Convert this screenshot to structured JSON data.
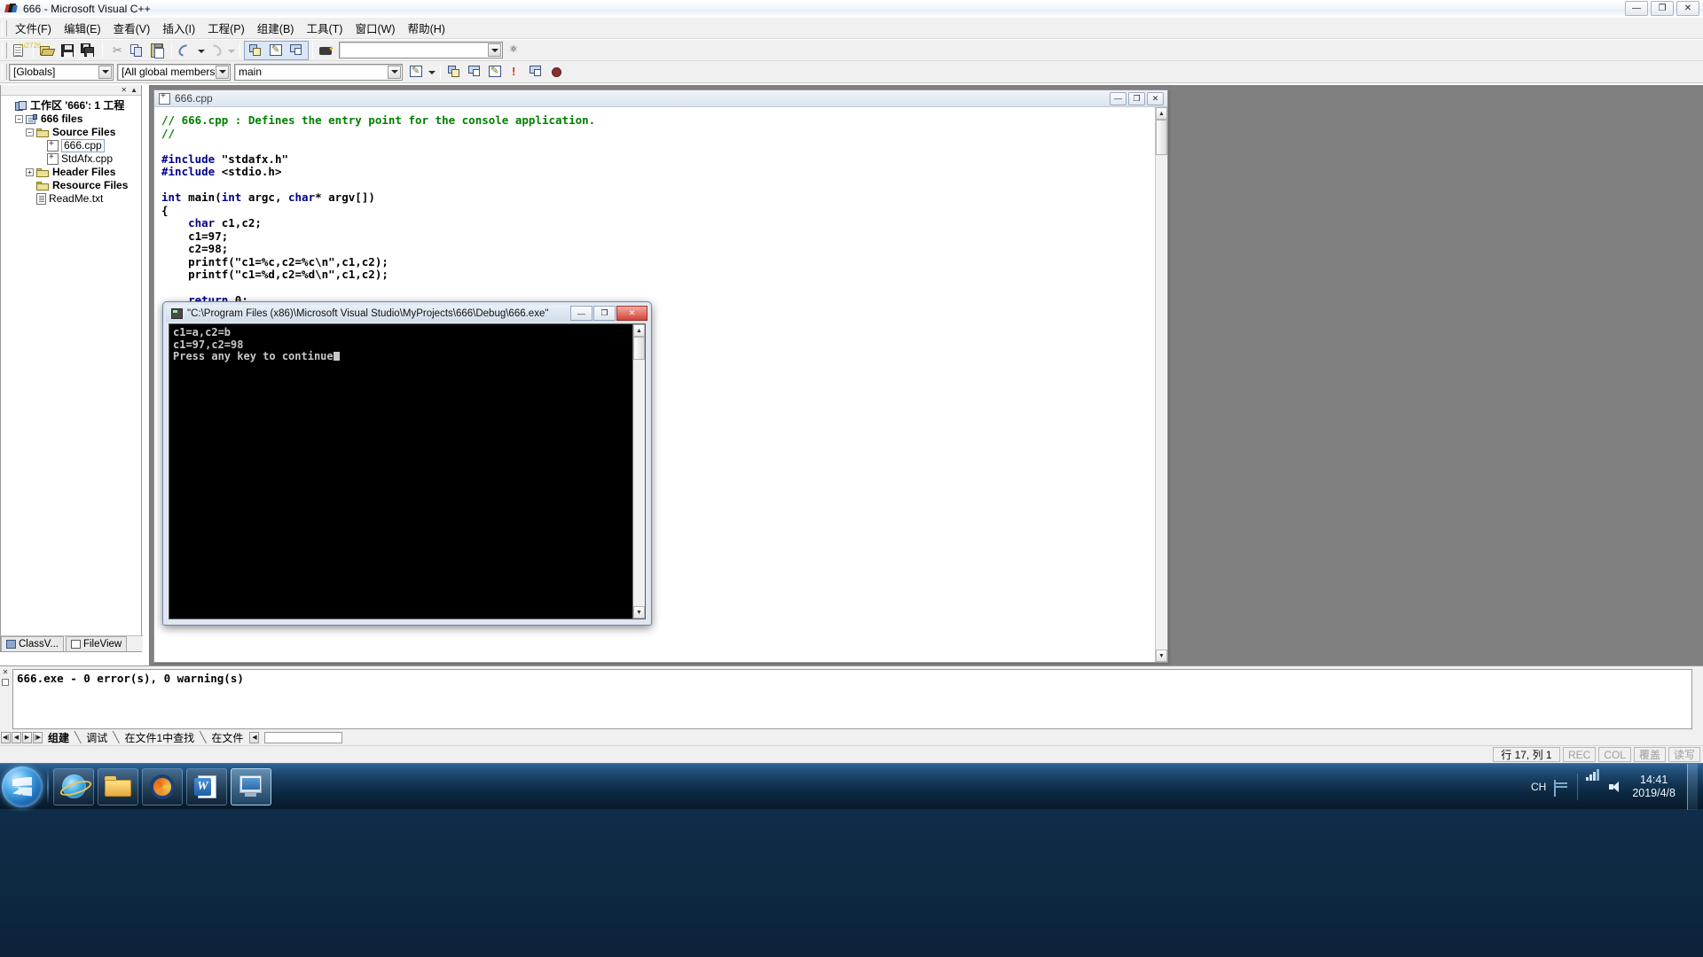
{
  "window": {
    "title": "666 - Microsoft Visual C++",
    "buttons": {
      "minimize": "—",
      "maximize": "❐",
      "close": "✕"
    }
  },
  "menu": {
    "items": [
      {
        "label": "文件(F)"
      },
      {
        "label": "编辑(E)"
      },
      {
        "label": "查看(V)"
      },
      {
        "label": "插入(I)"
      },
      {
        "label": "工程(P)"
      },
      {
        "label": "组建(B)"
      },
      {
        "label": "工具(T)"
      },
      {
        "label": "窗口(W)"
      },
      {
        "label": "帮助(H)"
      }
    ]
  },
  "toolbar": {
    "buttons": [
      {
        "name": "new-document",
        "icon": "new-document-icon"
      },
      {
        "name": "open-file",
        "icon": "open-folder-icon"
      },
      {
        "name": "save",
        "icon": "save-icon"
      },
      {
        "name": "save-all",
        "icon": "save-all-icon"
      },
      {
        "name": "cut",
        "icon": "scissors-icon"
      },
      {
        "name": "copy",
        "icon": "copy-icon"
      },
      {
        "name": "paste",
        "icon": "clipboard-icon"
      },
      {
        "name": "undo",
        "icon": "undo-arrow-icon"
      },
      {
        "name": "redo",
        "icon": "redo-arrow-icon"
      },
      {
        "name": "workspace",
        "icon": "workspace-window-icon"
      },
      {
        "name": "output-window",
        "icon": "output-window-icon"
      },
      {
        "name": "window-list",
        "icon": "window-list-icon"
      },
      {
        "name": "find-in-files",
        "icon": "binoculars-icon"
      }
    ],
    "find_box": {
      "value": "",
      "placeholder": ""
    },
    "find_button": {
      "name": "find-button",
      "icon": "binoculars-icon"
    }
  },
  "combobar": {
    "globals": {
      "value": "[Globals]"
    },
    "members": {
      "value": "[All global members"
    },
    "symbol": {
      "value": "main"
    },
    "extra_buttons": [
      {
        "name": "go-to-definition",
        "icon": "definition-icon"
      },
      {
        "name": "dropdown",
        "icon": "chevron-down-icon"
      }
    ]
  },
  "workspace": {
    "tree": [
      {
        "label": "工作区 '666': 1 工程",
        "indent": 0,
        "expander": "",
        "icon": "workspace-icon",
        "selected": false,
        "bold": true
      },
      {
        "label": "666 files",
        "indent": 1,
        "expander": "−",
        "icon": "project-icon",
        "selected": false,
        "bold": true
      },
      {
        "label": "Source Files",
        "indent": 2,
        "expander": "−",
        "icon": "folder-icon",
        "selected": false,
        "bold": true
      },
      {
        "label": "666.cpp",
        "indent": 3,
        "expander": "",
        "icon": "cpp-file-icon",
        "selected": true,
        "bold": false
      },
      {
        "label": "StdAfx.cpp",
        "indent": 3,
        "expander": "",
        "icon": "cpp-file-icon",
        "selected": false,
        "bold": false
      },
      {
        "label": "Header Files",
        "indent": 2,
        "expander": "+",
        "icon": "folder-icon",
        "selected": false,
        "bold": true
      },
      {
        "label": "Resource Files",
        "indent": 2,
        "expander": "",
        "icon": "folder-icon",
        "selected": false,
        "bold": true
      },
      {
        "label": "ReadMe.txt",
        "indent": 2,
        "expander": "",
        "icon": "text-file-icon",
        "selected": false,
        "bold": false
      }
    ],
    "tabs": [
      {
        "label": "ClassV...",
        "icon": "class-view-icon",
        "active": false
      },
      {
        "label": "FileView",
        "icon": "file-view-icon",
        "active": true
      }
    ]
  },
  "editor": {
    "tab_title": "666.cpp",
    "window_buttons": {
      "minimize": "—",
      "restore": "❐",
      "close": "✕"
    },
    "lines": [
      [
        {
          "t": "// 666.cpp : Defines the entry point for the console application.",
          "c": "cm"
        }
      ],
      [
        {
          "t": "//",
          "c": "cm"
        }
      ],
      [
        {
          "t": "",
          "c": ""
        }
      ],
      [
        {
          "t": "#include",
          "c": "pp"
        },
        {
          "t": " \"stdafx.h\"",
          "c": ""
        }
      ],
      [
        {
          "t": "#include",
          "c": "pp"
        },
        {
          "t": " <stdio.h>",
          "c": ""
        }
      ],
      [
        {
          "t": "",
          "c": ""
        }
      ],
      [
        {
          "t": "int",
          "c": "kw"
        },
        {
          "t": " main(",
          "c": ""
        },
        {
          "t": "int",
          "c": "kw"
        },
        {
          "t": " argc, ",
          "c": ""
        },
        {
          "t": "char",
          "c": "kw"
        },
        {
          "t": "* argv[])",
          "c": ""
        }
      ],
      [
        {
          "t": "{",
          "c": ""
        }
      ],
      [
        {
          "t": "    ",
          "c": ""
        },
        {
          "t": "char",
          "c": "kw"
        },
        {
          "t": " c1,c2;",
          "c": ""
        }
      ],
      [
        {
          "t": "    c1=97;",
          "c": ""
        }
      ],
      [
        {
          "t": "    c2=98;",
          "c": ""
        }
      ],
      [
        {
          "t": "    printf(\"c1=%c,c2=%c\\n\",c1,c2);",
          "c": ""
        }
      ],
      [
        {
          "t": "    printf(\"c1=%d,c2=%d\\n\",c1,c2);",
          "c": ""
        }
      ],
      [
        {
          "t": "",
          "c": ""
        }
      ],
      [
        {
          "t": "    ",
          "c": ""
        },
        {
          "t": "return",
          "c": "kw"
        },
        {
          "t": " 0;",
          "c": ""
        }
      ],
      [
        {
          "t": "}",
          "c": ""
        }
      ]
    ]
  },
  "console": {
    "title": "\"C:\\Program Files (x86)\\Microsoft Visual Studio\\MyProjects\\666\\Debug\\666.exe\"",
    "buttons": {
      "minimize": "—",
      "maximize": "❐",
      "close": "✕"
    },
    "lines": [
      "c1=a,c2=b",
      "c1=97,c2=98",
      "Press any key to continue"
    ]
  },
  "output": {
    "lines": [
      "666.exe - 0 error(s), 0 warning(s)"
    ],
    "tabs": [
      {
        "label": "组建",
        "active": true
      },
      {
        "label": "调试",
        "active": false
      },
      {
        "label": "在文件1中查找",
        "active": false
      },
      {
        "label": "在文件",
        "active": false
      }
    ],
    "separator": "╲"
  },
  "statusbar": {
    "position": "行 17, 列 1",
    "indicators": [
      {
        "label": "REC",
        "dim": true
      },
      {
        "label": "COL",
        "dim": true
      },
      {
        "label": "覆盖",
        "dim": true
      },
      {
        "label": "读写",
        "dim": true
      }
    ]
  },
  "taskbar": {
    "buttons": [
      {
        "name": "taskbar-ie",
        "icon": "internet-explorer-icon",
        "active": false
      },
      {
        "name": "taskbar-explorer",
        "icon": "folder-icon",
        "active": false
      },
      {
        "name": "taskbar-firefox",
        "icon": "firefox-icon",
        "active": false
      },
      {
        "name": "taskbar-word",
        "icon": "word-icon",
        "active": false,
        "letter": "W"
      },
      {
        "name": "taskbar-vcpp",
        "icon": "visual-cpp-icon",
        "active": true
      }
    ],
    "tray": {
      "ime": "CH",
      "icons": [
        {
          "name": "keyboard-icon"
        },
        {
          "name": "network-icon"
        },
        {
          "name": "volume-icon"
        }
      ],
      "time": "14:41",
      "date": "2019/4/8"
    }
  }
}
